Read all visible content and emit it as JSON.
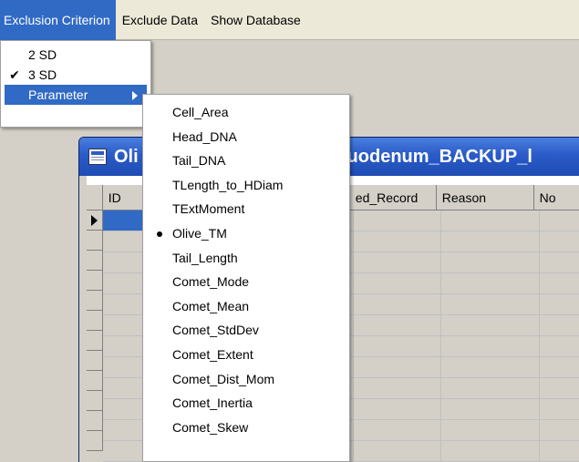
{
  "menubar": {
    "items": [
      {
        "label": "Exclusion Criterion",
        "active": true
      },
      {
        "label": "Exclude Data",
        "active": false
      },
      {
        "label": "Show Database",
        "active": false
      }
    ]
  },
  "exclusion_menu": {
    "items": [
      {
        "label": "2 SD",
        "checked": false
      },
      {
        "label": "3 SD",
        "checked": true,
        "check_glyph": "✔"
      },
      {
        "label": "Parameter",
        "has_submenu": true,
        "active": true
      }
    ]
  },
  "parameter_menu": {
    "items": [
      {
        "label": "Cell_Area"
      },
      {
        "label": "Head_DNA"
      },
      {
        "label": "Tail_DNA"
      },
      {
        "label": "TLength_to_HDiam"
      },
      {
        "label": "TExtMoment"
      },
      {
        "label": "Olive_TM",
        "selected": true
      },
      {
        "label": "Tail_Length"
      },
      {
        "label": "Comet_Mode"
      },
      {
        "label": "Comet_Mean"
      },
      {
        "label": "Comet_StdDev"
      },
      {
        "label": "Comet_Extent"
      },
      {
        "label": "Comet_Dist_Mom"
      },
      {
        "label": "Comet_Inertia"
      },
      {
        "label": "Comet_Skew"
      }
    ]
  },
  "child_window": {
    "title_left": "Oli",
    "title_right": ") : Duodenum_BACKUP_l",
    "columns": [
      "ID",
      "ed_Record",
      "Reason",
      "No"
    ]
  },
  "colors": {
    "menu_highlight": "#316ac5",
    "title_bar": "#2a5bc8",
    "workspace": "#d4d0c8"
  }
}
